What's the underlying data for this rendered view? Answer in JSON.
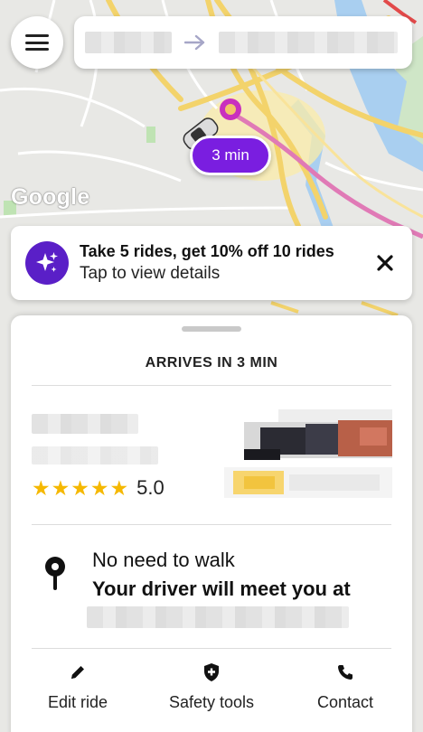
{
  "map": {
    "logo_text": "Google",
    "eta_label": "3 min"
  },
  "header": {
    "menu_icon": "hamburger-menu-icon",
    "route_arrow_icon": "arrow-right-icon"
  },
  "promo": {
    "icon": "sparkle-icon",
    "title": "Take 5 rides, get 10% off 10 rides",
    "subtitle": "Tap to view details",
    "close_icon": "close-icon"
  },
  "sheet": {
    "arrival_heading": "ARRIVES IN 3 MIN",
    "driver": {
      "stars": [
        "★",
        "★",
        "★",
        "★",
        "★"
      ],
      "rating": "5.0"
    },
    "pickup": {
      "icon": "map-pin-icon",
      "title": "No need to walk",
      "subtitle": "Your driver will meet you at"
    },
    "actions": [
      {
        "label": "Edit ride",
        "icon": "pencil-icon"
      },
      {
        "label": "Safety tools",
        "icon": "shield-plus-icon"
      },
      {
        "label": "Contact",
        "icon": "phone-icon"
      }
    ]
  },
  "colors": {
    "brand_purple": "#7a1ee0",
    "promo_icon_bg": "#5a1fc7",
    "star": "#f5b800",
    "route_line": "#e07ab6"
  }
}
